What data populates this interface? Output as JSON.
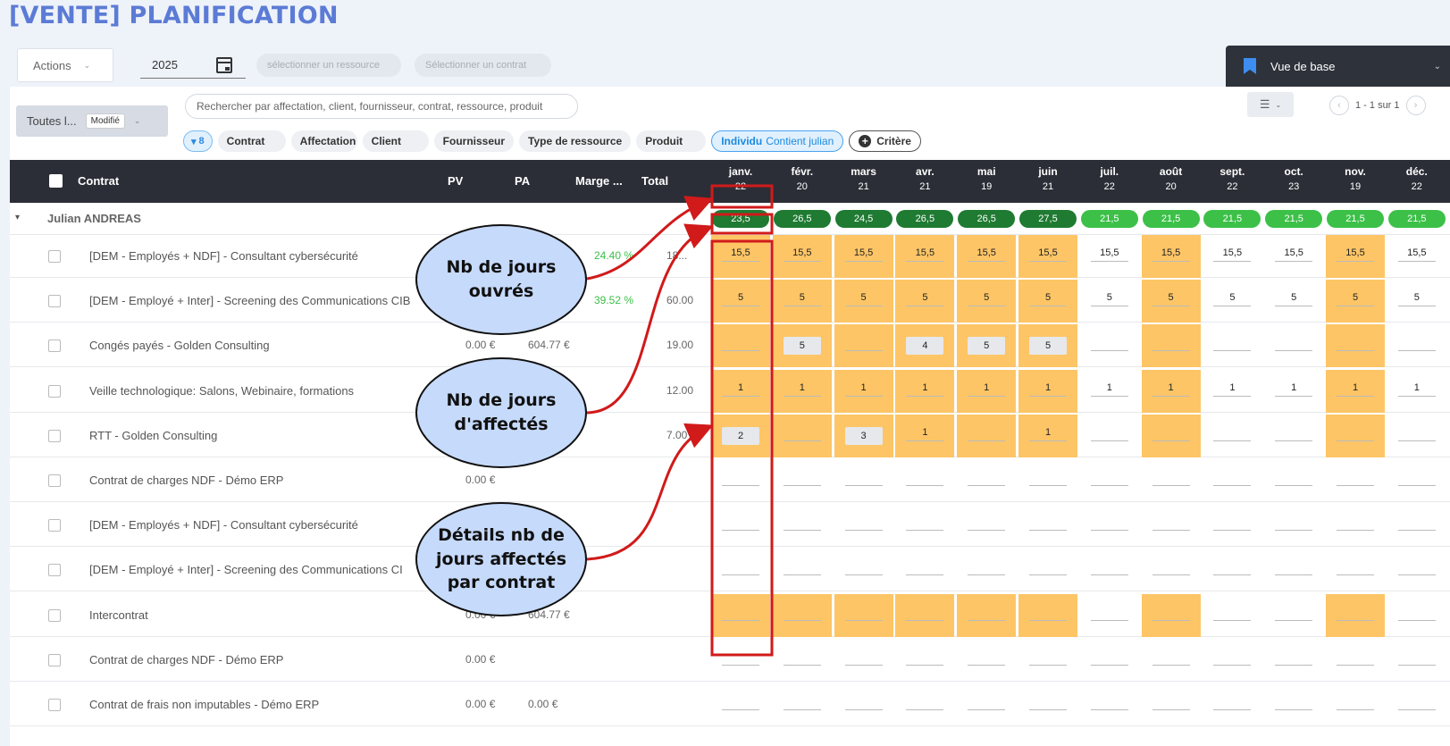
{
  "title": "[VENTE] PLANIFICATION",
  "toolbar": {
    "actions_label": "Actions",
    "year": "2025",
    "resource_placeholder": "sélectionner un ressource",
    "contract_placeholder": "Sélectionner un contrat",
    "view_label": "Vue de base"
  },
  "filters": {
    "select_label": "Toutes l...",
    "select_badge": "Modifié",
    "search_placeholder": "Rechercher par affectation, client, fournisseur, contrat, ressource, produit",
    "count": "8",
    "chips": [
      "Contrat",
      "Affectation",
      "Client",
      "Fournisseur",
      "Type de ressource",
      "Produit"
    ],
    "individu_key": "Individu",
    "individu_value": "Contient julian",
    "criteria_label": "Critère",
    "pager_text": "1 - 1 sur 1"
  },
  "table": {
    "headers": {
      "contract": "Contrat",
      "pv": "PV",
      "pa": "PA",
      "marge": "Marge ...",
      "total": "Total"
    },
    "months": [
      {
        "m": "janv.",
        "d": "22"
      },
      {
        "m": "févr.",
        "d": "20"
      },
      {
        "m": "mars",
        "d": "21"
      },
      {
        "m": "avr.",
        "d": "21"
      },
      {
        "m": "mai",
        "d": "19"
      },
      {
        "m": "juin",
        "d": "21"
      },
      {
        "m": "juil.",
        "d": "22"
      },
      {
        "m": "août",
        "d": "20"
      },
      {
        "m": "sept.",
        "d": "22"
      },
      {
        "m": "oct.",
        "d": "23"
      },
      {
        "m": "nov.",
        "d": "19"
      },
      {
        "m": "déc.",
        "d": "22"
      }
    ],
    "group": {
      "name": "Julian ANDREAS",
      "values": [
        "23,5",
        "26,5",
        "24,5",
        "26,5",
        "26,5",
        "27,5",
        "21,5",
        "21,5",
        "21,5",
        "21,5",
        "21,5",
        "21,5"
      ],
      "colors": [
        "#1f7a32",
        "#1f7a32",
        "#1f7a32",
        "#1f7a32",
        "#1f7a32",
        "#1f7a32",
        "#3cc048",
        "#3cc048",
        "#3cc048",
        "#3cc048",
        "#3cc048",
        "#3cc048"
      ]
    },
    "rows": [
      {
        "label": "[DEM - Employés + NDF] - Consultant cybersécurité",
        "pv": "",
        "pa": "",
        "marge": "24.40 %",
        "total": "18...",
        "cells": [
          "15,5",
          "15,5",
          "15,5",
          "15,5",
          "15,5",
          "15,5",
          "15,5",
          "15,5",
          "15,5",
          "15,5",
          "15,5",
          "15,5"
        ],
        "orange": true
      },
      {
        "label": "[DEM - Employé + Inter] - Screening des Communications CIB",
        "pv": "",
        "pa": "€",
        "marge": "39.52 %",
        "total": "60.00",
        "cells": [
          "5",
          "5",
          "5",
          "5",
          "5",
          "5",
          "5",
          "5",
          "5",
          "5",
          "5",
          "5"
        ],
        "orange": true
      },
      {
        "label": "Congés payés - Golden Consulting",
        "pv": "0.00 €",
        "pa": "604.77 €",
        "marge": "",
        "total": "19.00",
        "cells": [
          "",
          "5",
          "",
          "4",
          "5",
          "5",
          "",
          "",
          "",
          "",
          "",
          ""
        ],
        "boxed": [
          1,
          3,
          4,
          5
        ],
        "orange": true
      },
      {
        "label": "Veille technologique: Salons, Webinaire, formations",
        "pv": "",
        "pa": "",
        "marge": "",
        "total": "12.00",
        "cells": [
          "1",
          "1",
          "1",
          "1",
          "1",
          "1",
          "1",
          "1",
          "1",
          "1",
          "1",
          "1"
        ],
        "orange": true
      },
      {
        "label": "RTT - Golden Consulting",
        "pv": "",
        "pa": "",
        "marge": "",
        "total": "7.00",
        "cells": [
          "2",
          "",
          "3",
          "1",
          "",
          "1",
          "",
          "",
          "",
          "",
          "",
          ""
        ],
        "boxed": [
          0,
          2
        ],
        "orange": true
      },
      {
        "label": "Contrat de charges NDF - Démo ERP",
        "pv": "0.00 €",
        "pa": "",
        "marge": "",
        "total": "",
        "cells": [
          "",
          "",
          "",
          "",
          "",
          "",
          "",
          "",
          "",
          "",
          "",
          ""
        ],
        "orange": false
      },
      {
        "label": "[DEM - Employés + NDF] - Consultant cybersécurité",
        "pv": "",
        "pa": "",
        "marge": "",
        "total": "",
        "cells": [
          "",
          "",
          "",
          "",
          "",
          "",
          "",
          "",
          "",
          "",
          "",
          ""
        ],
        "orange": false
      },
      {
        "label": "[DEM - Employé + Inter] - Screening des Communications CI",
        "pv": "",
        "pa": "",
        "marge": "",
        "total": "",
        "cells": [
          "",
          "",
          "",
          "",
          "",
          "",
          "",
          "",
          "",
          "",
          "",
          ""
        ],
        "orange": false
      },
      {
        "label": "Intercontrat",
        "pv": "0.00 €",
        "pa": "604.77 €",
        "marge": "",
        "total": "",
        "cells": [
          "",
          "",
          "",
          "",
          "",
          "",
          "",
          "",
          "",
          "",
          "",
          ""
        ],
        "orange": true
      },
      {
        "label": "Contrat de charges NDF - Démo ERP",
        "pv": "0.00 €",
        "pa": "",
        "marge": "",
        "total": "",
        "cells": [
          "",
          "",
          "",
          "",
          "",
          "",
          "",
          "",
          "",
          "",
          "",
          ""
        ],
        "orange": false
      },
      {
        "label": "Contrat de frais non imputables - Démo ERP",
        "pv": "0.00 €",
        "pa": "0.00 €",
        "marge": "",
        "total": "",
        "cells": [
          "",
          "",
          "",
          "",
          "",
          "",
          "",
          "",
          "",
          "",
          "",
          ""
        ],
        "orange": false
      }
    ],
    "orange_months": [
      0,
      1,
      2,
      3,
      4,
      5,
      7,
      10
    ]
  },
  "annotations": {
    "callout1": "Nb de jours ouvrés",
    "callout2": "Nb de jours d'affectés",
    "callout3": "Détails nb de jours affectés par contrat",
    "accent": "#d11a1a"
  }
}
